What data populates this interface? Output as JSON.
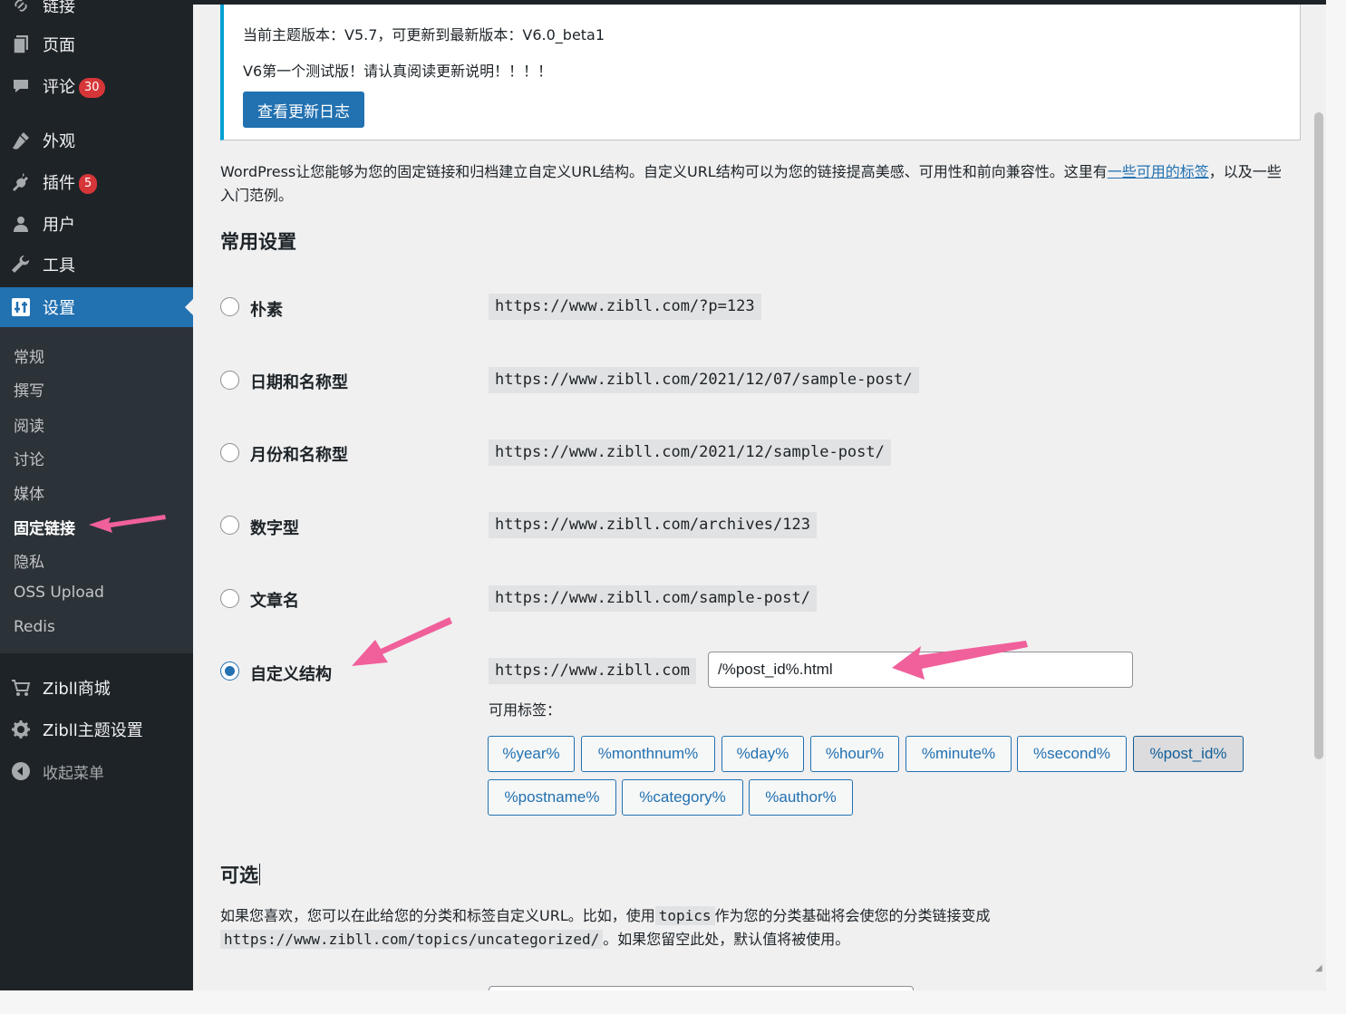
{
  "sidebar": {
    "items": [
      {
        "label": "链接",
        "icon": "link-icon"
      },
      {
        "label": "页面",
        "icon": "page-icon"
      },
      {
        "label": "评论",
        "icon": "comment-icon",
        "badge": "30"
      },
      {
        "label": "外观",
        "icon": "appearance-brush-icon"
      },
      {
        "label": "插件",
        "icon": "plugin-icon",
        "badge": "5"
      },
      {
        "label": "用户",
        "icon": "user-icon"
      },
      {
        "label": "工具",
        "icon": "wrench-icon"
      },
      {
        "label": "设置",
        "icon": "settings-icon"
      }
    ],
    "submenu": [
      "常规",
      "撰写",
      "阅读",
      "讨论",
      "媒体",
      "固定链接",
      "隐私",
      "OSS Upload",
      "Redis"
    ],
    "extra": [
      {
        "label": "Zibll商城",
        "icon": "cart-icon"
      },
      {
        "label": "Zibll主题设置",
        "icon": "gear-icon"
      },
      {
        "label": "收起菜单",
        "icon": "collapse-icon"
      }
    ]
  },
  "notice": {
    "line1": "当前主题版本：V5.7，可更新到最新版本：V6.0_beta1",
    "line2": "V6第一个测试版！请认真阅读更新说明！！！！",
    "button": "查看更新日志"
  },
  "intro": {
    "text": "WordPress让您能够为您的固定链接和归档建立自定义URL结构。自定义URL结构可以为您的链接提高美感、可用性和前向兼容性。这里有",
    "link": "一些可用的标签",
    "tail": "，以及一些入门范例。"
  },
  "common": {
    "title": "常用设置",
    "options": [
      {
        "label": "朴素",
        "example": "https://www.zibll.com/?p=123"
      },
      {
        "label": "日期和名称型",
        "example": "https://www.zibll.com/2021/12/07/sample-post/"
      },
      {
        "label": "月份和名称型",
        "example": "https://www.zibll.com/2021/12/sample-post/"
      },
      {
        "label": "数字型",
        "example": "https://www.zibll.com/archives/123"
      },
      {
        "label": "文章名",
        "example": "https://www.zibll.com/sample-post/"
      },
      {
        "label": "自定义结构",
        "example": "https://www.zibll.com"
      }
    ],
    "custom_value": "/%post_id%.html",
    "available_label": "可用标签：",
    "tags": [
      "%year%",
      "%monthnum%",
      "%day%",
      "%hour%",
      "%minute%",
      "%second%",
      "%post_id%",
      "%postname%",
      "%category%",
      "%author%"
    ]
  },
  "optional": {
    "title": "可选",
    "text1": "如果您喜欢，您可以在此给您的分类和标签自定义URL。比如，使用",
    "code1": "topics",
    "text2": "作为您的分类基础将会使您的分类链接变成",
    "code2": "https://www.zibll.com/topics/uncategorized/",
    "text3": "。如果您留空此处，默认值将被使用。"
  },
  "colors": {
    "accent": "#2271b1",
    "sidebar_bg": "#1e2327",
    "badge": "#d63638",
    "arrow": "#f0609a"
  }
}
